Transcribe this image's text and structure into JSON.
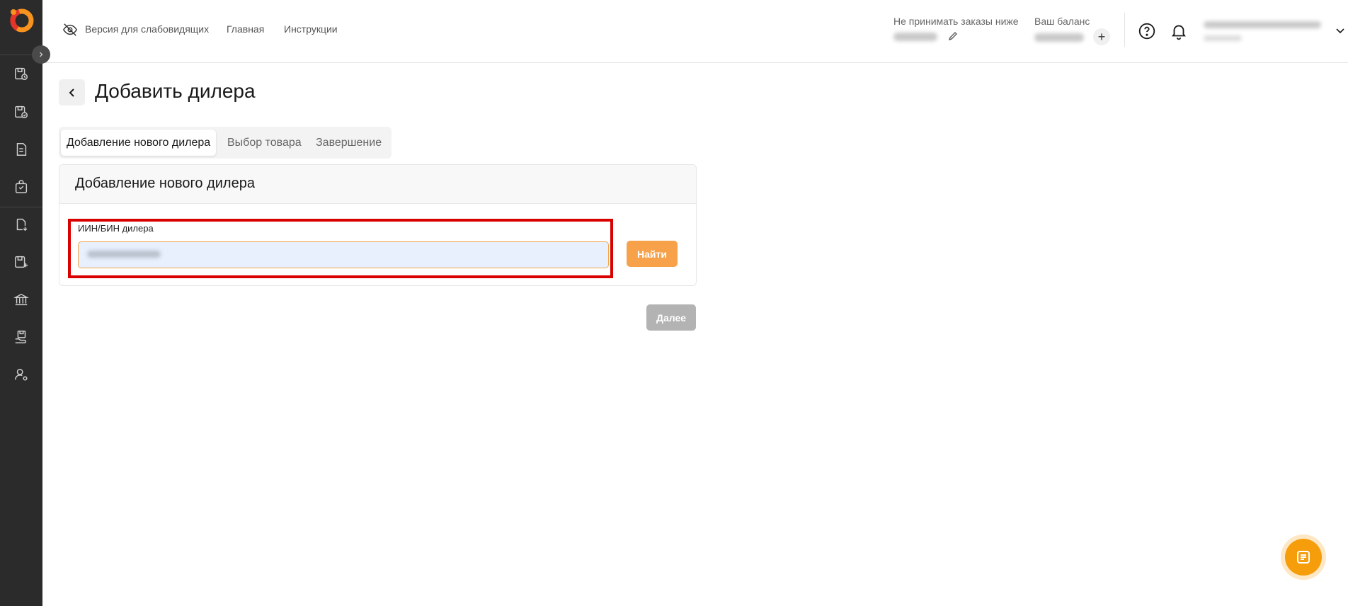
{
  "header": {
    "accessibility_label": "Версия для слабовидящих",
    "nav_home": "Главная",
    "nav_instructions": "Инструкции",
    "min_order_label": "Не принимать заказы ниже",
    "balance_label": "Ваш баланс",
    "add_balance": "+"
  },
  "page": {
    "title": "Добавить дилера"
  },
  "steps": [
    {
      "label": "Добавление нового дилера"
    },
    {
      "label": "Выбор товара"
    },
    {
      "label": "Завершение"
    }
  ],
  "card": {
    "title": "Добавление нового дилера",
    "field_label": "ИИН/БИН дилера",
    "find_button": "Найти"
  },
  "footer": {
    "next_button": "Далее"
  },
  "colors": {
    "accent": "#f7a24b",
    "sidebar": "#2b2b2b",
    "highlight": "#d90000",
    "disabled": "#b3b3b3"
  }
}
